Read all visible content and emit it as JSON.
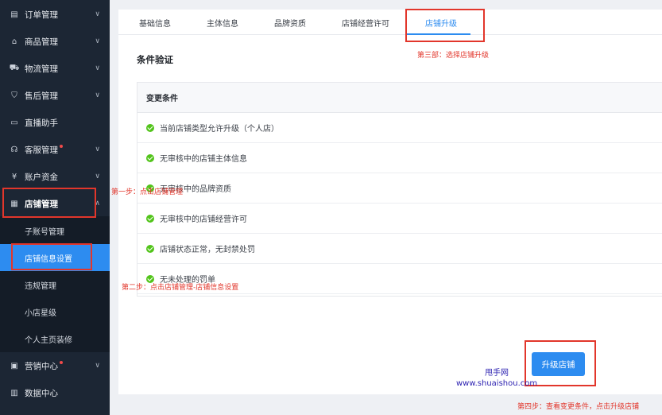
{
  "sidebar": {
    "items": [
      {
        "label": "订单管理",
        "icon": "order-icon",
        "dot": false
      },
      {
        "label": "商品管理",
        "icon": "product-icon",
        "dot": false
      },
      {
        "label": "物流管理",
        "icon": "truck-icon",
        "dot": false
      },
      {
        "label": "售后管理",
        "icon": "shield-icon",
        "dot": false
      },
      {
        "label": "直播助手",
        "icon": "video-icon",
        "dot": false
      },
      {
        "label": "客服管理",
        "icon": "headset-icon",
        "dot": true
      },
      {
        "label": "账户资金",
        "icon": "yen-icon",
        "dot": false
      },
      {
        "label": "店铺管理",
        "icon": "store-icon",
        "dot": false
      },
      {
        "label": "营销中心",
        "icon": "marketing-icon",
        "dot": true
      },
      {
        "label": "数据中心",
        "icon": "chart-icon",
        "dot": false
      }
    ],
    "sub_items": [
      "子账号管理",
      "店铺信息设置",
      "违规管理",
      "小店星级",
      "个人主页装修"
    ]
  },
  "tabs": [
    "基础信息",
    "主体信息",
    "品牌资质",
    "店铺经营许可",
    "店铺升级"
  ],
  "section_title": "条件验证",
  "table": {
    "header": "变更条件",
    "rows": [
      "当前店铺类型允许升级（个人店）",
      "无审核中的店铺主体信息",
      "无审核中的品牌资质",
      "无审核中的店铺经营许可",
      "店铺状态正常，无封禁处罚",
      "无未处理的罚单"
    ]
  },
  "upgrade_button": "升级店铺",
  "annotations": {
    "step1": "第一步：点击店铺管理",
    "step2": "第二步：点击店铺管理-店铺信息设置",
    "step3": "第三部：选择店铺升级",
    "step4": "第四步：查看变更条件，点击升级店铺"
  },
  "watermark": {
    "line1": "甩手网",
    "line2": "www.shuaishou.com"
  },
  "colors": {
    "sidebar_bg": "#1c2634",
    "accent": "#2d8cf0",
    "annotation": "#e2362b",
    "success": "#52c41a"
  }
}
